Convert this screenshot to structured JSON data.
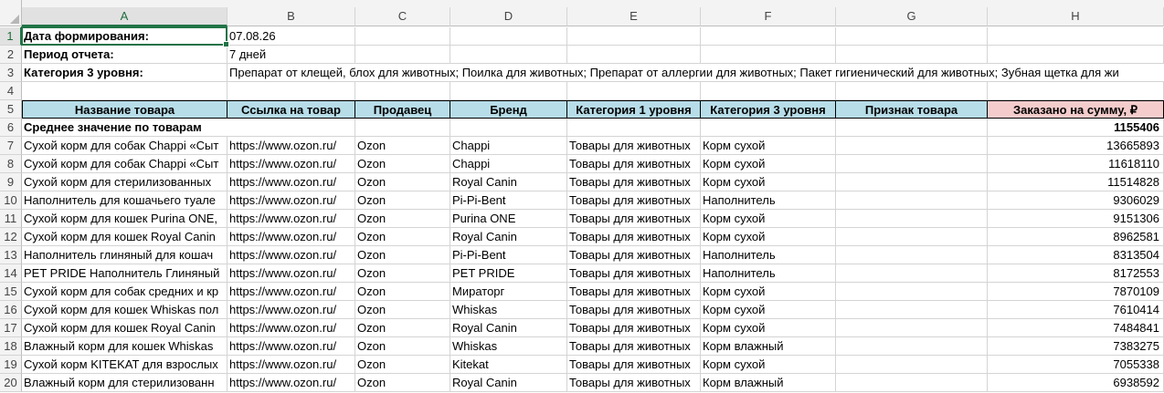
{
  "columns": [
    "A",
    "B",
    "C",
    "D",
    "E",
    "F",
    "G",
    "H"
  ],
  "rows": [
    "1",
    "2",
    "3",
    "4",
    "5",
    "6",
    "7",
    "8",
    "9",
    "10",
    "11",
    "12",
    "13",
    "14",
    "15",
    "16",
    "17",
    "18",
    "19",
    "20"
  ],
  "meta": {
    "date_label": "Дата формирования:",
    "date_value": "07.08.26",
    "period_label": "Период отчета:",
    "period_value": "7 дней",
    "category_label": "Категория 3 уровня:",
    "category_value": "Препарат от клещей, блох для животных; Поилка для животных; Препарат от аллергии для животных; Пакет гигиенический для животных; Зубная щетка для жи"
  },
  "headers": [
    "Название товара",
    "Ссылка на товар",
    "Продавец",
    "Бренд",
    "Категория 1 уровня",
    "Категория 3 уровня",
    "Признак товара",
    "Заказано на сумму, ₽"
  ],
  "average": {
    "label": "Среднее значение по товарам",
    "value": "1155406"
  },
  "items": [
    [
      "Сухой корм для собак Chappi «Сыт",
      "https://www.ozon.ru/",
      "Ozon",
      "Chappi",
      "Товары для животных",
      "Корм сухой",
      "",
      "13665893"
    ],
    [
      "Сухой корм для собак Chappi «Сыт",
      "https://www.ozon.ru/",
      "Ozon",
      "Chappi",
      "Товары для животных",
      "Корм сухой",
      "",
      "11618110"
    ],
    [
      "Сухой корм для стерилизованных",
      "https://www.ozon.ru/",
      "Ozon",
      "Royal Canin",
      "Товары для животных",
      "Корм сухой",
      "",
      "11514828"
    ],
    [
      "Наполнитель для кошачьего туале",
      "https://www.ozon.ru/",
      "Ozon",
      "Pi-Pi-Bent",
      "Товары для животных",
      "Наполнитель",
      "",
      "9306029"
    ],
    [
      "Сухой корм для кошек Purina ONE,",
      "https://www.ozon.ru/",
      "Ozon",
      "Purina ONE",
      "Товары для животных",
      "Корм сухой",
      "",
      "9151306"
    ],
    [
      "Сухой корм для кошек Royal Canin",
      "https://www.ozon.ru/",
      "Ozon",
      "Royal Canin",
      "Товары для животных",
      "Корм сухой",
      "",
      "8962581"
    ],
    [
      "Наполнитель глиняный для кошач",
      "https://www.ozon.ru/",
      "Ozon",
      "Pi-Pi-Bent",
      "Товары для животных",
      "Наполнитель",
      "",
      "8313504"
    ],
    [
      "PET PRIDE Наполнитель Глиняный",
      "https://www.ozon.ru/",
      "Ozon",
      "PET PRIDE",
      "Товары для животных",
      "Наполнитель",
      "",
      "8172553"
    ],
    [
      "Сухой корм для собак средних и кр",
      "https://www.ozon.ru/",
      "Ozon",
      "Мираторг",
      "Товары для животных",
      "Корм сухой",
      "",
      "7870109"
    ],
    [
      "Сухой корм для кошек Whiskas пол",
      "https://www.ozon.ru/",
      "Ozon",
      "Whiskas",
      "Товары для животных",
      "Корм сухой",
      "",
      "7610414"
    ],
    [
      "Сухой корм для кошек Royal Canin",
      "https://www.ozon.ru/",
      "Ozon",
      "Royal Canin",
      "Товары для животных",
      "Корм сухой",
      "",
      "7484841"
    ],
    [
      "Влажный корм для кошек Whiskas",
      "https://www.ozon.ru/",
      "Ozon",
      "Whiskas",
      "Товары для животных",
      "Корм влажный",
      "",
      "7383275"
    ],
    [
      "Сухой корм KITEKAT для взрослых",
      "https://www.ozon.ru/",
      "Ozon",
      "Kitekat",
      "Товары для животных",
      "Корм сухой",
      "",
      "7055338"
    ],
    [
      "Влажный корм для стерилизованн",
      "https://www.ozon.ru/",
      "Ozon",
      "Royal Canin",
      "Товары для животных",
      "Корм влажный",
      "",
      "6938592"
    ]
  ]
}
